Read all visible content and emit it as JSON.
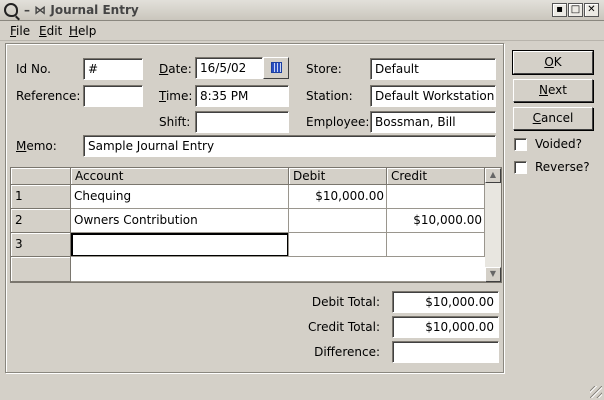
{
  "window": {
    "title": "Journal Entry",
    "title_prefix": "–",
    "controls": {
      "minimize": "▪",
      "maximize": "□",
      "close": "✕"
    }
  },
  "menu": [
    {
      "mnemonic": "F",
      "rest": "ile"
    },
    {
      "mnemonic": "E",
      "rest": "dit"
    },
    {
      "mnemonic": "H",
      "rest": "elp"
    }
  ],
  "form": {
    "id_no": {
      "label": "Id No.",
      "value": "#"
    },
    "reference": {
      "label": "Reference:",
      "value": ""
    },
    "date": {
      "mnemonic": "D",
      "label_rest": "ate:",
      "value": "16/5/02"
    },
    "time": {
      "mnemonic": "T",
      "label_rest": "ime:",
      "value": "8:35 PM"
    },
    "shift": {
      "label": "Shift:",
      "value": ""
    },
    "store": {
      "label": "Store:",
      "value": "Default"
    },
    "station": {
      "label": "Station:",
      "value": "Default Workstation"
    },
    "employee": {
      "label": "Employee:",
      "value": "Bossman, Bill"
    },
    "memo": {
      "mnemonic": "M",
      "label_rest": "emo:",
      "value": "Sample Journal Entry"
    }
  },
  "grid": {
    "columns": [
      "Account",
      "Debit",
      "Credit"
    ],
    "rows": [
      {
        "num": "1",
        "account": "Chequing",
        "debit": "$10,000.00",
        "credit": ""
      },
      {
        "num": "2",
        "account": "Owners Contribution",
        "debit": "",
        "credit": "$10,000.00"
      },
      {
        "num": "3",
        "account": "",
        "debit": "",
        "credit": ""
      }
    ],
    "scroll_up": "▲",
    "scroll_down": "▼"
  },
  "totals": {
    "debit_label": "Debit Total:",
    "debit_value": "$10,000.00",
    "credit_label": "Credit Total:",
    "credit_value": "$10,000.00",
    "difference_label": "Difference:",
    "difference_value": ""
  },
  "buttons": {
    "ok": {
      "mnemonic": "O",
      "rest": "K"
    },
    "next": {
      "mnemonic": "N",
      "rest": "ext"
    },
    "cancel": {
      "mnemonic": "C",
      "rest": "ancel"
    }
  },
  "checks": {
    "voided": {
      "label": "Voided?",
      "checked": false
    },
    "reverse": {
      "label": "Reverse?",
      "checked": false
    }
  },
  "colors": {
    "face": "#d4d0c8",
    "field": "#ffffff",
    "shadow": "#7a766e"
  }
}
